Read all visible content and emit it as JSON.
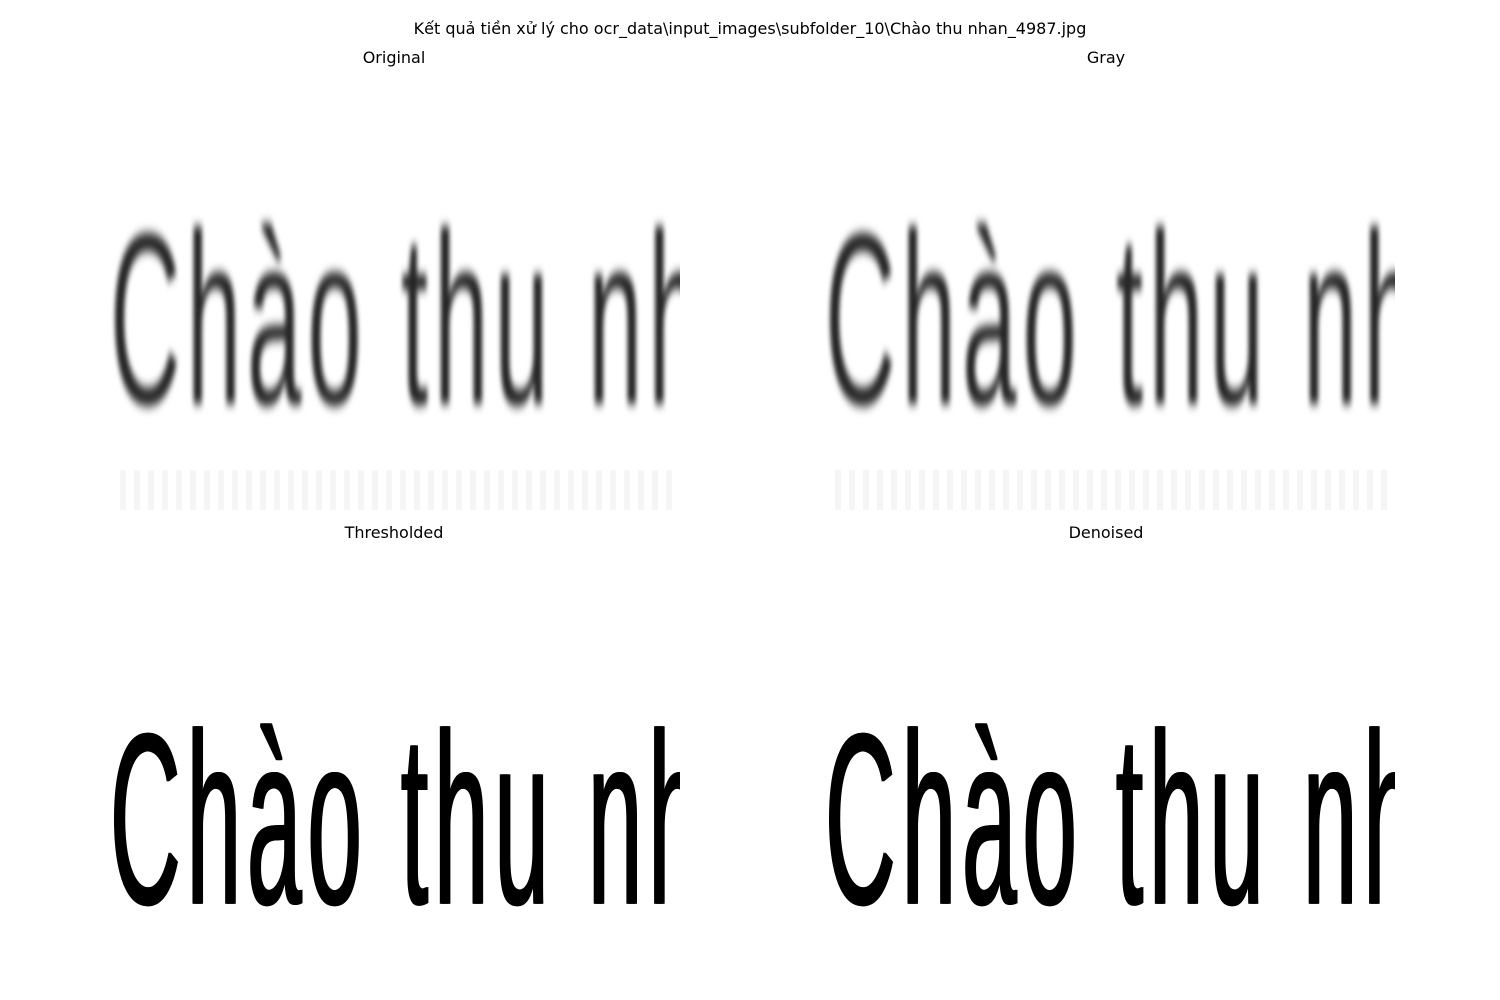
{
  "figure": {
    "suptitle": "Kết quả tiền xử lý cho ocr_data\\input_images\\subfolder_10\\Chào thu nhan_4987.jpg"
  },
  "panels": [
    {
      "title": "Original",
      "image_text": "Chào thu nhan"
    },
    {
      "title": "Gray",
      "image_text": "Chào thu nhan"
    },
    {
      "title": "Thresholded",
      "image_text": "Chào thu nhan"
    },
    {
      "title": "Denoised",
      "image_text": "Chào thu nhan"
    }
  ]
}
